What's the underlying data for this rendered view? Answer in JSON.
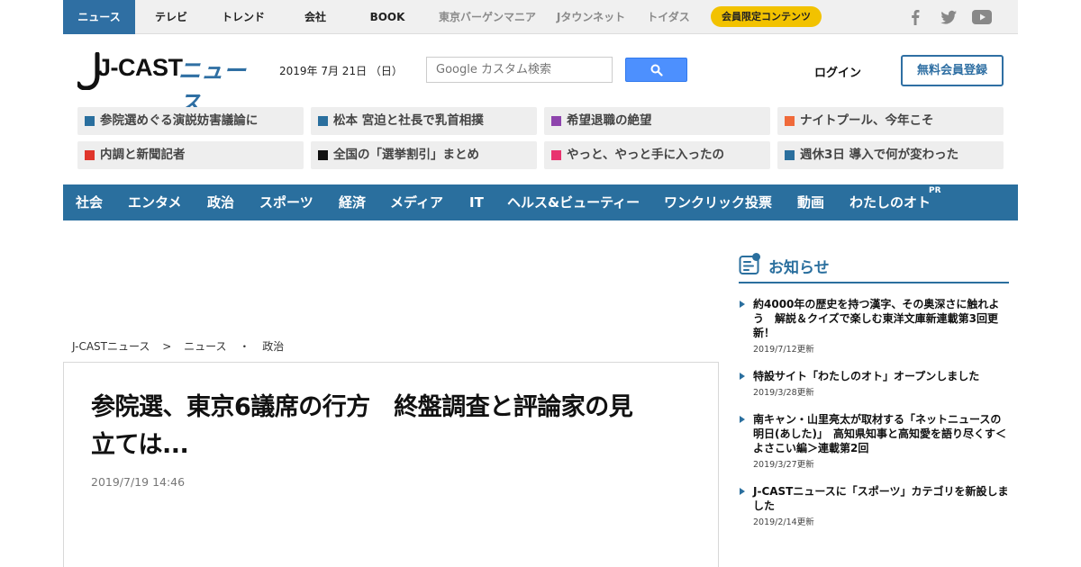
{
  "topnav": {
    "items": [
      "ニュース",
      "テレビ",
      "トレンド",
      "会社",
      "BOOK",
      "東京バーゲンマニア",
      "Jタウンネット",
      "トイダス"
    ],
    "member_badge": "会員限定コンテンツ",
    "social_icons": [
      "facebook-icon",
      "twitter-icon",
      "youtube-icon"
    ]
  },
  "header": {
    "logo_main": "J-CAST",
    "logo_sub": "ニュース",
    "date": "2019年 7月 21日 （日）",
    "search_placeholder": "Google カスタム検索",
    "login": "ログイン",
    "register": "無料会員登録"
  },
  "pickups": [
    {
      "text": "参院選めぐる演説妨害議論に",
      "color": "#2a6f9e"
    },
    {
      "text": "松本 宮迫と社長で乳首相撲",
      "color": "#2a6f9e"
    },
    {
      "text": "希望退職の絶望",
      "color": "#8e44ad"
    },
    {
      "text": "ナイトプール、今年こそ",
      "color": "#f06a3a"
    },
    {
      "text": "内調と新聞記者",
      "color": "#e0352b"
    },
    {
      "text": "全国の「選挙割引」まとめ",
      "color": "#111111"
    },
    {
      "text": "やっと、やっと手に入ったの",
      "color": "#e8336f"
    },
    {
      "text": "週休3日 導入で何が変わった",
      "color": "#2a6f9e"
    }
  ],
  "categories": [
    "社会",
    "エンタメ",
    "政治",
    "スポーツ",
    "経済",
    "メディア",
    "IT",
    "ヘルス&ビューティー",
    "ワンクリック投票",
    "動画",
    "わたしのオト"
  ],
  "category_pr": "PR",
  "breadcrumb": [
    "J-CASTニュース",
    ">",
    "ニュース",
    "・",
    "政治"
  ],
  "article": {
    "title_line1": "参院選、東京6議席の行方　終盤調査と評論家の見",
    "title_line2": "立ては...",
    "date": "2019/7/19 14:46"
  },
  "notices": {
    "title": "お知らせ",
    "items": [
      {
        "line1": "約4000年の歴史を持つ漢字、その奥深さに触れよ",
        "line2": "う　解説＆クイズで楽しむ東洋文庫新連載第3回更",
        "line3": "新！",
        "date": "2019/7/12更新"
      },
      {
        "line1": "特設サイト「わたしのオト」オープンしました",
        "date": "2019/3/28更新"
      },
      {
        "line1": "南キャン・山里亮太が取材する「ネットニュースの",
        "line2": "明日(あした)」　高知県知事と高知愛を語り尽くす＜",
        "line3": "よさこい編＞連載第2回",
        "date": "2019/3/27更新"
      },
      {
        "line1": "J-CASTニュースに「スポーツ」カテゴリを新設しま",
        "line2": "した",
        "date": "2019/2/14更新"
      }
    ]
  },
  "colors": {
    "brand_blue": "#2a6f9e",
    "badge_yellow": "#f2c200"
  }
}
